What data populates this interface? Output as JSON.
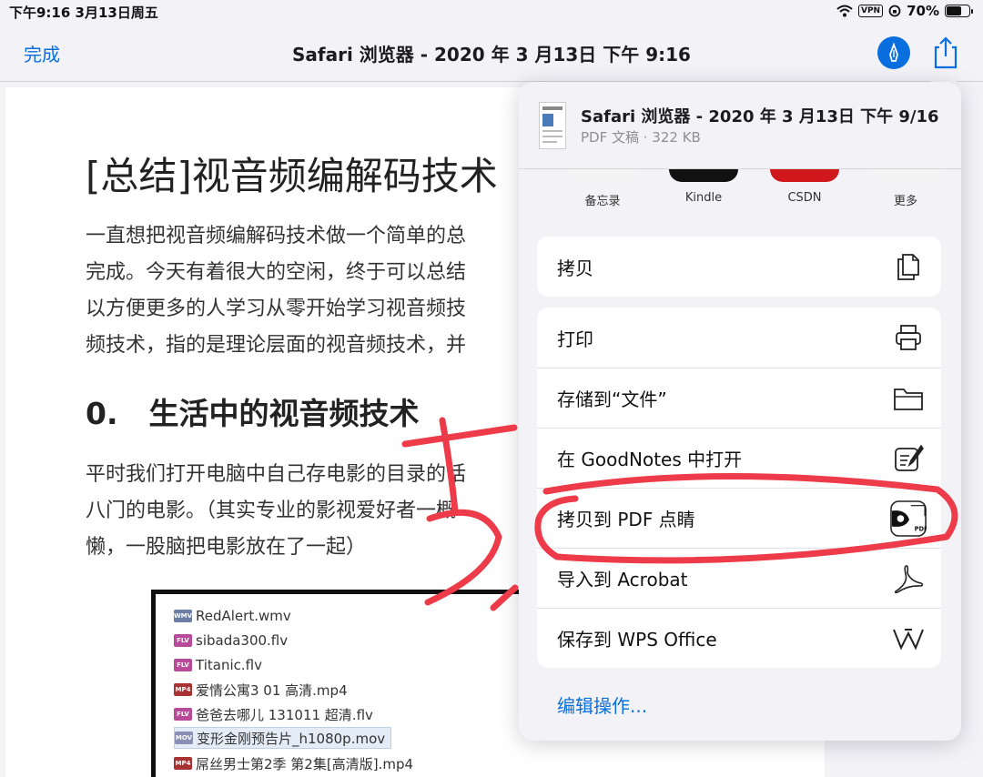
{
  "status": {
    "time": "下午9:16   3月13日周五",
    "vpn": "VPN",
    "battery": "70%",
    "battery_level": 0.7
  },
  "nav": {
    "done": "完成",
    "title": "Safari 浏览器 - 2020 年 3 月13日 下午 9:16"
  },
  "doc": {
    "heading": "[总结]视音频编解码技术",
    "paragraph1": [
      "一直想把视音频编解码技术做一个简单的总",
      "完成。今天有着很大的空闲，终于可以总结",
      "以方便更多的人学习从零开始学习视音频技",
      "频技术，指的是理论层面的视音频技术，并"
    ],
    "section_num": "0.",
    "section_title": "生活中的视音频技术",
    "paragraph2": [
      "平时我们打开电脑中自己存电影的目录的话",
      "八门的电影。（其实专业的影视爱好者一概",
      "懒，一股脑把电影放在了一起）"
    ],
    "files": [
      {
        "tag": "WMV",
        "name": "RedAlert.wmv",
        "color": "#6b7fa6"
      },
      {
        "tag": "FLV",
        "name": "sibada300.flv",
        "color": "#b94a9a"
      },
      {
        "tag": "FLV",
        "name": "Titanic.flv",
        "color": "#b94a9a"
      },
      {
        "tag": "MP4",
        "name": "爱情公寓3 01 高清.mp4",
        "color": "#a83232"
      },
      {
        "tag": "FLV",
        "name": "爸爸去哪儿 131011 超清.flv",
        "color": "#b94a9a"
      },
      {
        "tag": "MOV",
        "name": "变形金刚预告片_h1080p.mov",
        "color": "#8a8fb8"
      },
      {
        "tag": "MP4",
        "name": "屌丝男士第2季 第2集[高清版].mp4",
        "color": "#a83232"
      }
    ]
  },
  "sheet": {
    "title": "Safari 浏览器 - 2020 年 3 月13日 下午 9/16",
    "subtitle": "PDF 文稿 · 322 KB",
    "apps": [
      {
        "label": "备忘录",
        "color": "#f4f4f4"
      },
      {
        "label": "Kindle",
        "color": "#111111"
      },
      {
        "label": "CSDN",
        "color": "#d0181c"
      },
      {
        "label": "更多",
        "color": "#f4f4f4"
      }
    ],
    "copy": "拷贝",
    "actions": [
      "打印",
      "存储到“文件”",
      "在 GoodNotes 中打开",
      "拷贝到 PDF 点睛",
      "导入到 Acrobat",
      "保存到 WPS Office"
    ],
    "pdf_tag": "PDF",
    "edit": "编辑操作..."
  },
  "colors": {
    "accent": "#0a6fde",
    "annotation": "#ee3b4a"
  }
}
